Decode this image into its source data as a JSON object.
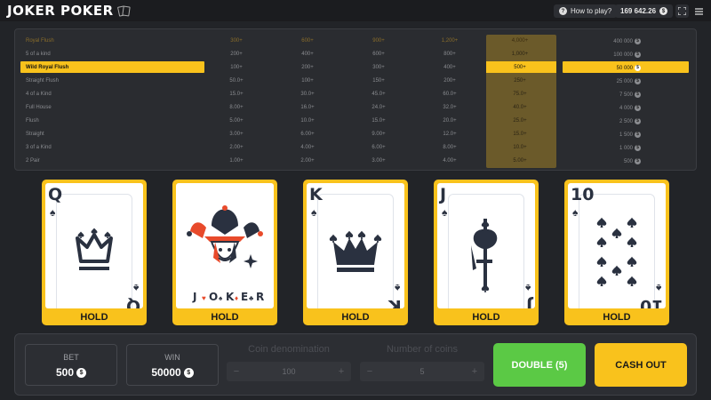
{
  "header": {
    "title": "JOKER POKER",
    "how_to_play": "How to play?",
    "balance": "169 642.26",
    "icons": [
      "question-icon",
      "coin-icon",
      "fullscreen-icon",
      "menu-icon"
    ]
  },
  "paytable": {
    "rows": [
      {
        "name": "Royal Flush",
        "cells": [
          "300+",
          "600+",
          "900+",
          "1,200+",
          "4,000+"
        ],
        "payout": "400 000"
      },
      {
        "name": "5 of a kind",
        "cells": [
          "200+",
          "400+",
          "600+",
          "800+",
          "1,000+"
        ],
        "payout": "100 000"
      },
      {
        "name": "Wild Royal Flush",
        "cells": [
          "100+",
          "200+",
          "300+",
          "400+",
          "500+"
        ],
        "payout": "50 000"
      },
      {
        "name": "Straight Flush",
        "cells": [
          "50.0+",
          "100+",
          "150+",
          "200+",
          "250+"
        ],
        "payout": "25 000"
      },
      {
        "name": "4 of a Kind",
        "cells": [
          "15.0+",
          "30.0+",
          "45.0+",
          "60.0+",
          "75.0+"
        ],
        "payout": "7 500"
      },
      {
        "name": "Full House",
        "cells": [
          "8.00+",
          "16.0+",
          "24.0+",
          "32.0+",
          "40.0+"
        ],
        "payout": "4 000"
      },
      {
        "name": "Flush",
        "cells": [
          "5.00+",
          "10.0+",
          "15.0+",
          "20.0+",
          "25.0+"
        ],
        "payout": "2 500"
      },
      {
        "name": "Straight",
        "cells": [
          "3.00+",
          "6.00+",
          "9.00+",
          "12.0+",
          "15.0+"
        ],
        "payout": "1 500"
      },
      {
        "name": "3 of a Kind",
        "cells": [
          "2.00+",
          "4.00+",
          "6.00+",
          "8.00+",
          "10.0+"
        ],
        "payout": "1 000"
      },
      {
        "name": "2 Pair",
        "cells": [
          "1.00+",
          "2.00+",
          "3.00+",
          "4.00+",
          "5.00+"
        ],
        "payout": "500"
      }
    ],
    "active_row": 2
  },
  "cards": [
    {
      "rank": "Q",
      "suit": "♠",
      "figure": "crown-small",
      "hold": "HOLD"
    },
    {
      "rank": "",
      "suit": "",
      "figure": "joker",
      "hold": "HOLD",
      "joker_text": [
        "J",
        "O",
        "K",
        "E",
        "R"
      ]
    },
    {
      "rank": "K",
      "suit": "♠",
      "figure": "crown-large",
      "hold": "HOLD"
    },
    {
      "rank": "J",
      "suit": "♠",
      "figure": "sword-axe",
      "hold": "HOLD"
    },
    {
      "rank": "10",
      "suit": "♠",
      "figure": "pips",
      "hold": "HOLD"
    }
  ],
  "controls": {
    "bet_label": "BET",
    "bet_value": "500",
    "win_label": "WIN",
    "win_value": "50000",
    "coin_denom_label": "Coin denomination",
    "coin_denom_value": "100",
    "num_coins_label": "Number of coins",
    "num_coins_value": "5",
    "minus": "−",
    "plus": "+",
    "double_label": "DOUBLE (5)",
    "cashout_label": "CASH OUT"
  },
  "colors": {
    "accent": "#f9c21c",
    "double": "#5bc945",
    "background": "#222428"
  }
}
